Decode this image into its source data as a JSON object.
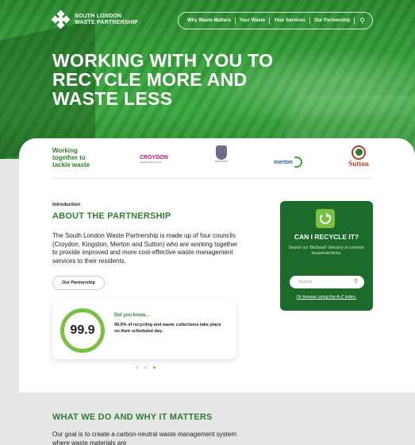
{
  "brand": {
    "name_line1": "SOUTH LONDON",
    "name_line2": "WASTE PARTNERSHIP"
  },
  "nav": {
    "items": [
      "Why Waste Matters",
      "Your Waste",
      "Your Services",
      "Our Partnership"
    ],
    "search_icon": "search-icon"
  },
  "hero": {
    "title": "WORKING WITH YOU TO RECYCLE MORE AND WASTE LESS"
  },
  "partners": {
    "tagline_l1": "Working",
    "tagline_l2": "together to",
    "tagline_l3": "tackle waste",
    "croydon": "CROYDON",
    "croydon_url": "www.croydon.gov.uk",
    "kingston": "KINGSTON",
    "merton": "merton",
    "sutton": "Sutton"
  },
  "about": {
    "label": "Introduction",
    "title": "ABOUT THE PARTNERSHIP",
    "body": "The South London Waste Partnership is made up of four councils (Croydon, Kingston, Merton and Sutton) who are working together to provide improved and more cost-effective waste management services to their residents.",
    "button": "Our Partnership"
  },
  "did_you_know": {
    "value": "99.9",
    "title": "Did you know...",
    "text": "99.9% of recycling and waste collections take place on their scheduled day."
  },
  "recycle_box": {
    "title": "CAN I RECYCLE IT?",
    "subtitle": "Search our 'BinSmart' directory of common household items.",
    "search_placeholder": "Search",
    "link": "Or browse using the A-Z index."
  },
  "section2": {
    "title": "WHAT WE DO AND WHY IT MATTERS",
    "body": "Our goal is to create a carbon-neutral waste management system where waste materials are"
  },
  "colors": {
    "brand_green": "#2e7d32",
    "hero_green": "#37a23b",
    "ring_green": "#7ac143",
    "box_green": "#1d6b2b",
    "dot_active": "#f08a2a"
  }
}
